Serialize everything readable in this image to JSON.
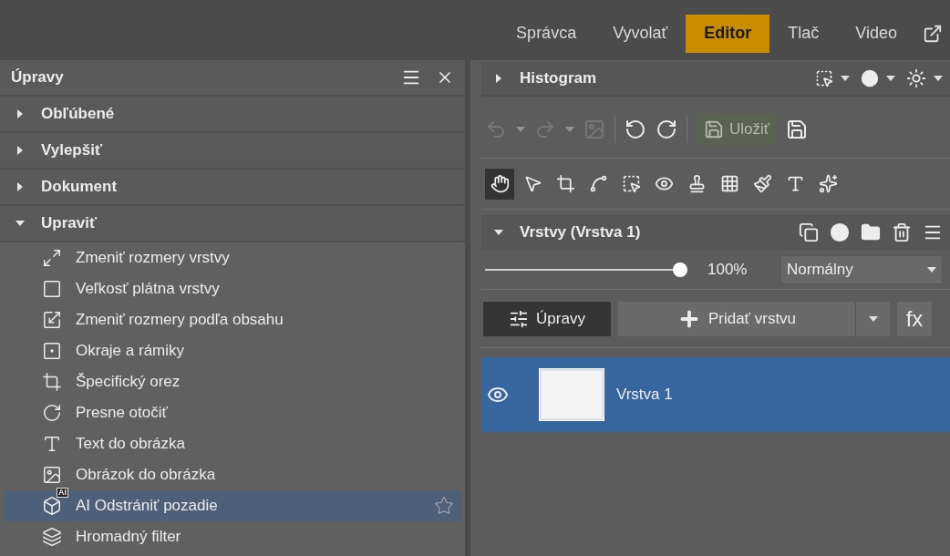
{
  "tabs": [
    {
      "label": "Správca",
      "selected": false
    },
    {
      "label": "Vyvolať",
      "selected": false
    },
    {
      "label": "Editor",
      "selected": true
    },
    {
      "label": "Tlač",
      "selected": false
    },
    {
      "label": "Video",
      "selected": false
    }
  ],
  "left_panel": {
    "title": "Úpravy",
    "sections": [
      {
        "label": "Obľúbené",
        "expanded": false
      },
      {
        "label": "Vylepšiť",
        "expanded": false
      },
      {
        "label": "Dokument",
        "expanded": false
      },
      {
        "label": "Upraviť",
        "expanded": true,
        "items": [
          {
            "label": "Zmeniť rozmery vrstvy",
            "selected": false
          },
          {
            "label": "Veľkosť plátna vrstvy",
            "selected": false
          },
          {
            "label": "Zmeniť rozmery podľa obsahu",
            "selected": false
          },
          {
            "label": "Okraje a rámiky",
            "selected": false
          },
          {
            "label": "Špecifický orez",
            "selected": false
          },
          {
            "label": "Presne otočiť",
            "selected": false
          },
          {
            "label": "Text do obrázka",
            "selected": false
          },
          {
            "label": "Obrázok do obrázka",
            "selected": false
          },
          {
            "label": "AI Odstrániť pozadie",
            "selected": true,
            "badge": "AI"
          },
          {
            "label": "Hromadný filter",
            "selected": false
          }
        ]
      }
    ]
  },
  "histogram": {
    "title": "Histogram",
    "expanded": false
  },
  "toolbar": {
    "save_label": "Uložiť",
    "save_disabled": true
  },
  "tools": [
    {
      "selected": true
    },
    {
      "selected": false
    },
    {
      "selected": false
    },
    {
      "selected": false
    },
    {
      "selected": false
    },
    {
      "selected": false
    },
    {
      "selected": false
    },
    {
      "selected": false
    },
    {
      "selected": false
    },
    {
      "selected": false
    },
    {
      "selected": false
    }
  ],
  "layers": {
    "title": "Vrstvy (Vrstva 1)",
    "expanded": true,
    "opacity": {
      "level": 1,
      "reading": "100%"
    },
    "blend_mode": "Normálny",
    "adjust_button": "Úpravy",
    "add_button": "Pridať vrstvu",
    "fx_button": "fx",
    "items": [
      {
        "name": "Vrstva 1",
        "selected": true,
        "visible": true
      }
    ]
  }
}
